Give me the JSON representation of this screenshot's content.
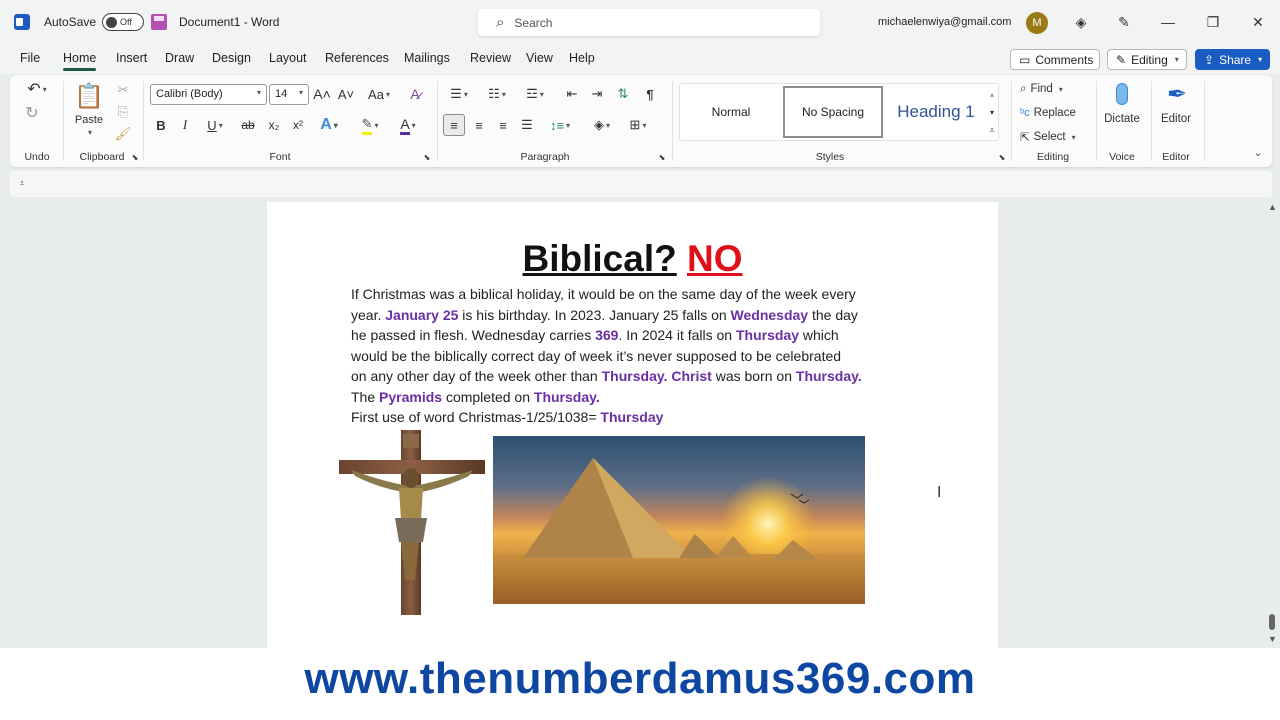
{
  "titlebar": {
    "app_icon": "word-logo-icon",
    "autosave_label": "AutoSave",
    "autosave_state": "Off",
    "save_icon": "save-icon",
    "document_title": "Document1 - Word",
    "search_placeholder": "Search",
    "account_email": "michaelenwiya@gmail.com",
    "avatar_initial": "M",
    "icons": [
      "diamond-icon",
      "pen-icon",
      "minimize-icon",
      "restore-icon",
      "close-icon"
    ],
    "glyphs": {
      "diamond": "◈",
      "pen": "✎",
      "minimize": "—",
      "restore": "❐",
      "close": "✕",
      "search": "⌕"
    }
  },
  "menu": {
    "tabs": [
      "File",
      "Home",
      "Insert",
      "Draw",
      "Design",
      "Layout",
      "References",
      "Mailings",
      "Review",
      "View",
      "Help"
    ],
    "active_tab": "Home",
    "comments_label": "Comments",
    "editing_label": "Editing",
    "share_label": "Share"
  },
  "ribbon": {
    "undo_label": "Undo",
    "clipboard": {
      "label": "Clipboard",
      "paste_label": "Paste"
    },
    "font": {
      "label": "Font",
      "font_name": "Calibri (Body)",
      "font_size": "14",
      "bold": "B",
      "italic": "I",
      "underline": "U",
      "strike": "ab",
      "subscript": "x₂",
      "superscript": "x²",
      "grow": "A˄",
      "shrink": "A˅",
      "change_case": "Aa"
    },
    "paragraph": {
      "label": "Paragraph"
    },
    "styles": {
      "label": "Styles",
      "items": [
        "Normal",
        "No Spacing",
        "Heading 1"
      ],
      "selected": "No Spacing"
    },
    "editing": {
      "label": "Editing",
      "find": "Find",
      "replace": "Replace",
      "select": "Select"
    },
    "voice": {
      "label": "Voice",
      "dictate": "Dictate"
    },
    "editor": {
      "label": "Editor",
      "editor_button": "Editor"
    }
  },
  "document": {
    "title_part1": "Biblical?",
    "title_part2": "NO",
    "title_colors": {
      "part1": "#111111",
      "part2": "#e0101a"
    },
    "highlight_color": "#6a2fa3",
    "lines": [
      [
        {
          "t": "If Christmas was a biblical holiday, it would be on the same day of the week every",
          "h": false
        }
      ],
      [
        {
          "t": "year. ",
          "h": false
        },
        {
          "t": "January 25",
          "h": true
        },
        {
          "t": " is his birthday. In 2023. January 25 falls on ",
          "h": false
        },
        {
          "t": "Wednesday",
          "h": true
        },
        {
          "t": " the day",
          "h": false
        }
      ],
      [
        {
          "t": "he passed in flesh. Wednesday carries ",
          "h": false
        },
        {
          "t": "369",
          "h": true
        },
        {
          "t": ". In 2024 it falls on ",
          "h": false
        },
        {
          "t": "Thursday",
          "h": true
        },
        {
          "t": " which",
          "h": false
        }
      ],
      [
        {
          "t": "would be the biblically correct day of week it’s never supposed to be celebrated",
          "h": false
        }
      ],
      [
        {
          "t": "on any other day of the week other than ",
          "h": false
        },
        {
          "t": "Thursday. Christ",
          "h": true
        },
        {
          "t": " was born on ",
          "h": false
        },
        {
          "t": "Thursday.",
          "h": true
        }
      ],
      [
        {
          "t": "The ",
          "h": false
        },
        {
          "t": "Pyramids",
          "h": true
        },
        {
          "t": " completed on ",
          "h": false
        },
        {
          "t": "Thursday.",
          "h": true
        }
      ],
      [
        {
          "t": "First use of word Christmas-1/25/1038= ",
          "h": false
        },
        {
          "t": "Thursday",
          "h": true
        }
      ]
    ],
    "images": [
      "crucifix-image",
      "pyramids-image"
    ]
  },
  "banner": {
    "text": "www.thenumberdamus369.com",
    "color": "#0d47a1"
  }
}
